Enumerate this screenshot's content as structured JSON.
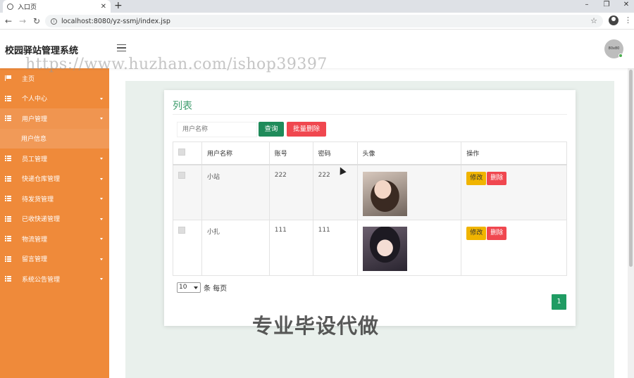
{
  "browser": {
    "tab_title": "入口页",
    "url": "localhost:8080/yz-ssmj/index.jsp"
  },
  "header": {
    "app_title": "校园驿站管理系统",
    "avatar_text": "80x80"
  },
  "watermark": "https://www.huzhan.com/ishop39397",
  "overlay_text": "专业毕设代做",
  "sidebar": {
    "items": [
      {
        "label": "主页"
      },
      {
        "label": "个人中心"
      },
      {
        "label": "用户管理"
      },
      {
        "label": "用户信息"
      },
      {
        "label": "员工管理"
      },
      {
        "label": "快递仓库管理"
      },
      {
        "label": "待发货管理"
      },
      {
        "label": "已收快递管理"
      },
      {
        "label": "物流管理"
      },
      {
        "label": "留言管理"
      },
      {
        "label": "系统公告管理"
      }
    ]
  },
  "list": {
    "title": "列表",
    "search_placeholder": "用户名称",
    "query_label": "查询",
    "batch_delete_label": "批量删除",
    "columns": [
      "用户名称",
      "账号",
      "密码",
      "头像",
      "操作"
    ],
    "rows": [
      {
        "name": "小站",
        "account": "222",
        "password": "222"
      },
      {
        "name": "小扎",
        "account": "111",
        "password": "111"
      }
    ],
    "edit_label": "修改",
    "delete_label": "删除",
    "page_size": "10",
    "page_size_suffix": "条 每页",
    "current_page": "1"
  },
  "colors": {
    "sidebar": "#ef8a3a",
    "accent_green": "#1f8b5a",
    "danger": "#f0474f",
    "warning": "#f0b400"
  }
}
